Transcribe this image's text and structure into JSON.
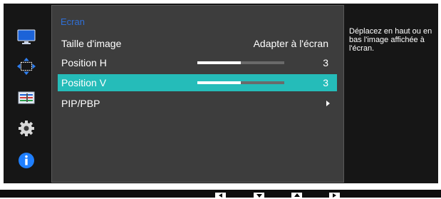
{
  "menu": {
    "title": "Ecran",
    "items": [
      {
        "label": "Taille d'image",
        "value": "Adapter à l'écran",
        "control": "text"
      },
      {
        "label": "Position H",
        "value": "3",
        "level": 0.5,
        "control": "slider"
      },
      {
        "label": "Position V",
        "value": "3",
        "level": 0.5,
        "control": "slider",
        "selected": true
      },
      {
        "label": "PIP/PBP",
        "value": "",
        "control": "arrow"
      }
    ]
  },
  "sidebar": {
    "icons": [
      "monitor-icon",
      "screen-position-icon",
      "picture-settings-icon",
      "gear-icon",
      "info-icon"
    ],
    "selected": "screen-position-icon"
  },
  "help": {
    "text": "Déplacez en haut ou en bas l'image affichée à l'écran."
  },
  "bottom_bar": {
    "buttons": [
      "left-arrow-icon",
      "down-arrow-icon",
      "up-arrow-icon",
      "right-arrow-icon"
    ]
  },
  "colors": {
    "title": "#2f6fd6",
    "selection": "#25bcb9",
    "panel": "#3d3d3d",
    "background": "#161616"
  }
}
